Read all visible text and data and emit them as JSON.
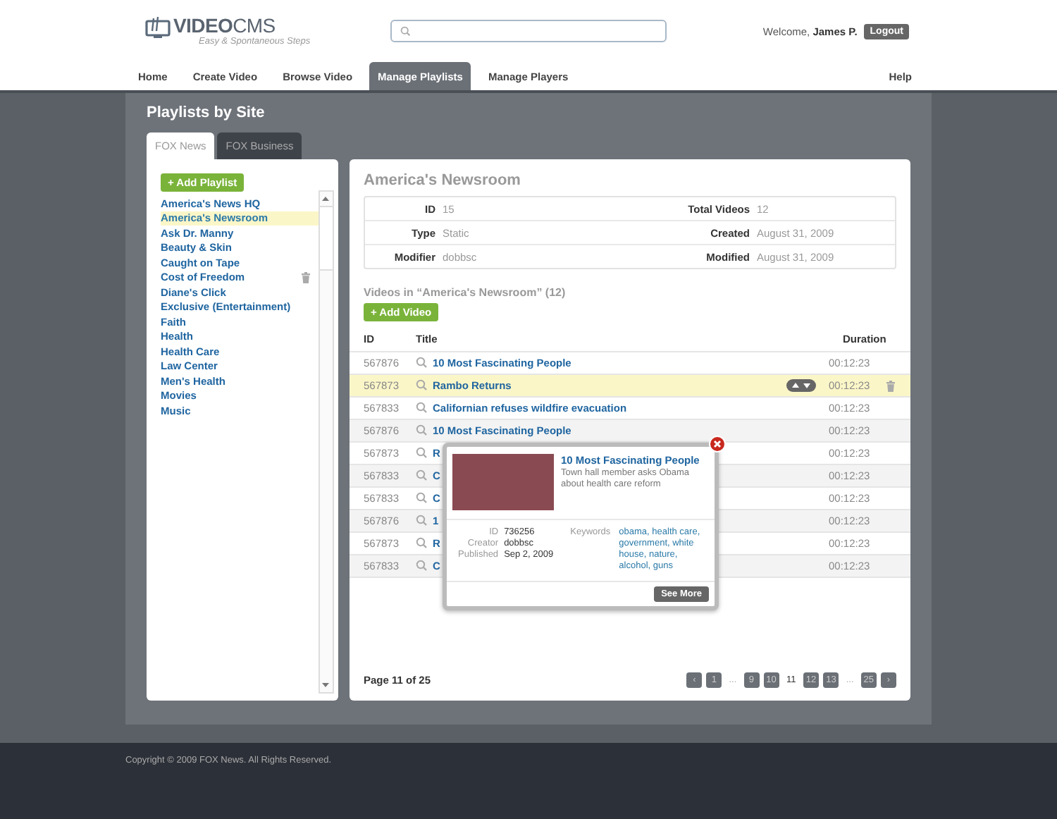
{
  "header": {
    "logo_bold": "VIDEO",
    "logo_light": "CMS",
    "tagline": "Easy & Spontaneous Steps",
    "welcome": "Welcome,",
    "user": "James P.",
    "logout": "Logout"
  },
  "nav": [
    {
      "label": "Home",
      "selected": false
    },
    {
      "label": "Create Video",
      "selected": false
    },
    {
      "label": "Browse Video",
      "selected": false
    },
    {
      "label": "Manage Playlists",
      "selected": true
    },
    {
      "label": "Manage Players",
      "selected": false
    }
  ],
  "help": "Help",
  "page_title": "Playlists by Site",
  "site_tabs": [
    {
      "label": "FOX News",
      "selected": true
    },
    {
      "label": "FOX Business",
      "selected": false
    }
  ],
  "playlists": {
    "add_button": "+ Add Playlist",
    "items": [
      {
        "label": "America's News HQ",
        "selected": false,
        "hovered": false
      },
      {
        "label": "America's Newsroom",
        "selected": true,
        "hovered": false
      },
      {
        "label": "Ask Dr. Manny",
        "selected": false,
        "hovered": false
      },
      {
        "label": "Beauty & Skin",
        "selected": false,
        "hovered": false
      },
      {
        "label": "Caught on Tape",
        "selected": false,
        "hovered": false
      },
      {
        "label": "Cost of Freedom",
        "selected": false,
        "hovered": true
      },
      {
        "label": "Diane's Click",
        "selected": false,
        "hovered": false
      },
      {
        "label": "Exclusive (Entertainment)",
        "selected": false,
        "hovered": false
      },
      {
        "label": "Faith",
        "selected": false,
        "hovered": false
      },
      {
        "label": "Health",
        "selected": false,
        "hovered": false
      },
      {
        "label": "Health Care",
        "selected": false,
        "hovered": false
      },
      {
        "label": "Law Center",
        "selected": false,
        "hovered": false
      },
      {
        "label": "Men's Health",
        "selected": false,
        "hovered": false
      },
      {
        "label": "Movies",
        "selected": false,
        "hovered": false
      },
      {
        "label": "Music",
        "selected": false,
        "hovered": false
      }
    ]
  },
  "detail": {
    "title": "America's Newsroom",
    "fields": [
      {
        "label": "ID",
        "value": "15"
      },
      {
        "label": "Total Videos",
        "value": "12"
      },
      {
        "label": "Type",
        "value": "Static"
      },
      {
        "label": "Created",
        "value": "August 31, 2009"
      },
      {
        "label": "Modifier",
        "value": "dobbsc"
      },
      {
        "label": "Modified",
        "value": "August 31, 2009"
      }
    ]
  },
  "videos": {
    "heading": "Videos in “America's Newsroom” (12)",
    "add_button": "+ Add Video",
    "columns": [
      "ID",
      "Title",
      "Duration"
    ],
    "rows": [
      {
        "id": "567876",
        "title": "10 Most Fascinating People",
        "duration": "00:12:23",
        "selected": false
      },
      {
        "id": "567873",
        "title": "Rambo Returns",
        "duration": "00:12:23",
        "selected": true
      },
      {
        "id": "567833",
        "title": "Californian refuses wildfire evacuation",
        "duration": "00:12:23",
        "selected": false
      },
      {
        "id": "567876",
        "title": "10 Most Fascinating People",
        "duration": "00:12:23",
        "selected": false
      },
      {
        "id": "567873",
        "title": "R",
        "duration": "00:12:23",
        "selected": false
      },
      {
        "id": "567833",
        "title": "C",
        "duration": "00:12:23",
        "selected": false
      },
      {
        "id": "567833",
        "title": "C",
        "duration": "00:12:23",
        "selected": false
      },
      {
        "id": "567876",
        "title": "1",
        "duration": "00:12:23",
        "selected": false
      },
      {
        "id": "567873",
        "title": "R",
        "duration": "00:12:23",
        "selected": false
      },
      {
        "id": "567833",
        "title": "C",
        "duration": "00:12:23",
        "selected": false
      }
    ]
  },
  "popup": {
    "title": "10 Most Fascinating People",
    "description": "Town hall member asks Obama about health care reform",
    "fields": [
      {
        "label": "ID",
        "value": "736256"
      },
      {
        "label": "Creator",
        "value": "dobbsc"
      },
      {
        "label": "Published",
        "value": "Sep 2, 2009"
      }
    ],
    "keywords_label": "Keywords",
    "keywords": "obama, health care, government, white house, nature, alcohol, guns",
    "button": "See More"
  },
  "pagination": {
    "summary": "Page 11 of 25",
    "pages": [
      {
        "kind": "prev",
        "label": "‹"
      },
      {
        "kind": "page",
        "label": "1",
        "selected": false
      },
      {
        "kind": "ellipsis",
        "label": "..."
      },
      {
        "kind": "page",
        "label": "9",
        "selected": false
      },
      {
        "kind": "page",
        "label": "10",
        "selected": false
      },
      {
        "kind": "page",
        "label": "11",
        "selected": true
      },
      {
        "kind": "page",
        "label": "12",
        "selected": false
      },
      {
        "kind": "page",
        "label": "13",
        "selected": false
      },
      {
        "kind": "ellipsis",
        "label": "..."
      },
      {
        "kind": "page",
        "label": "25",
        "selected": false
      },
      {
        "kind": "next",
        "label": "›"
      }
    ]
  },
  "footer": "Copyright © 2009 FOX News. All Rights Reserved."
}
